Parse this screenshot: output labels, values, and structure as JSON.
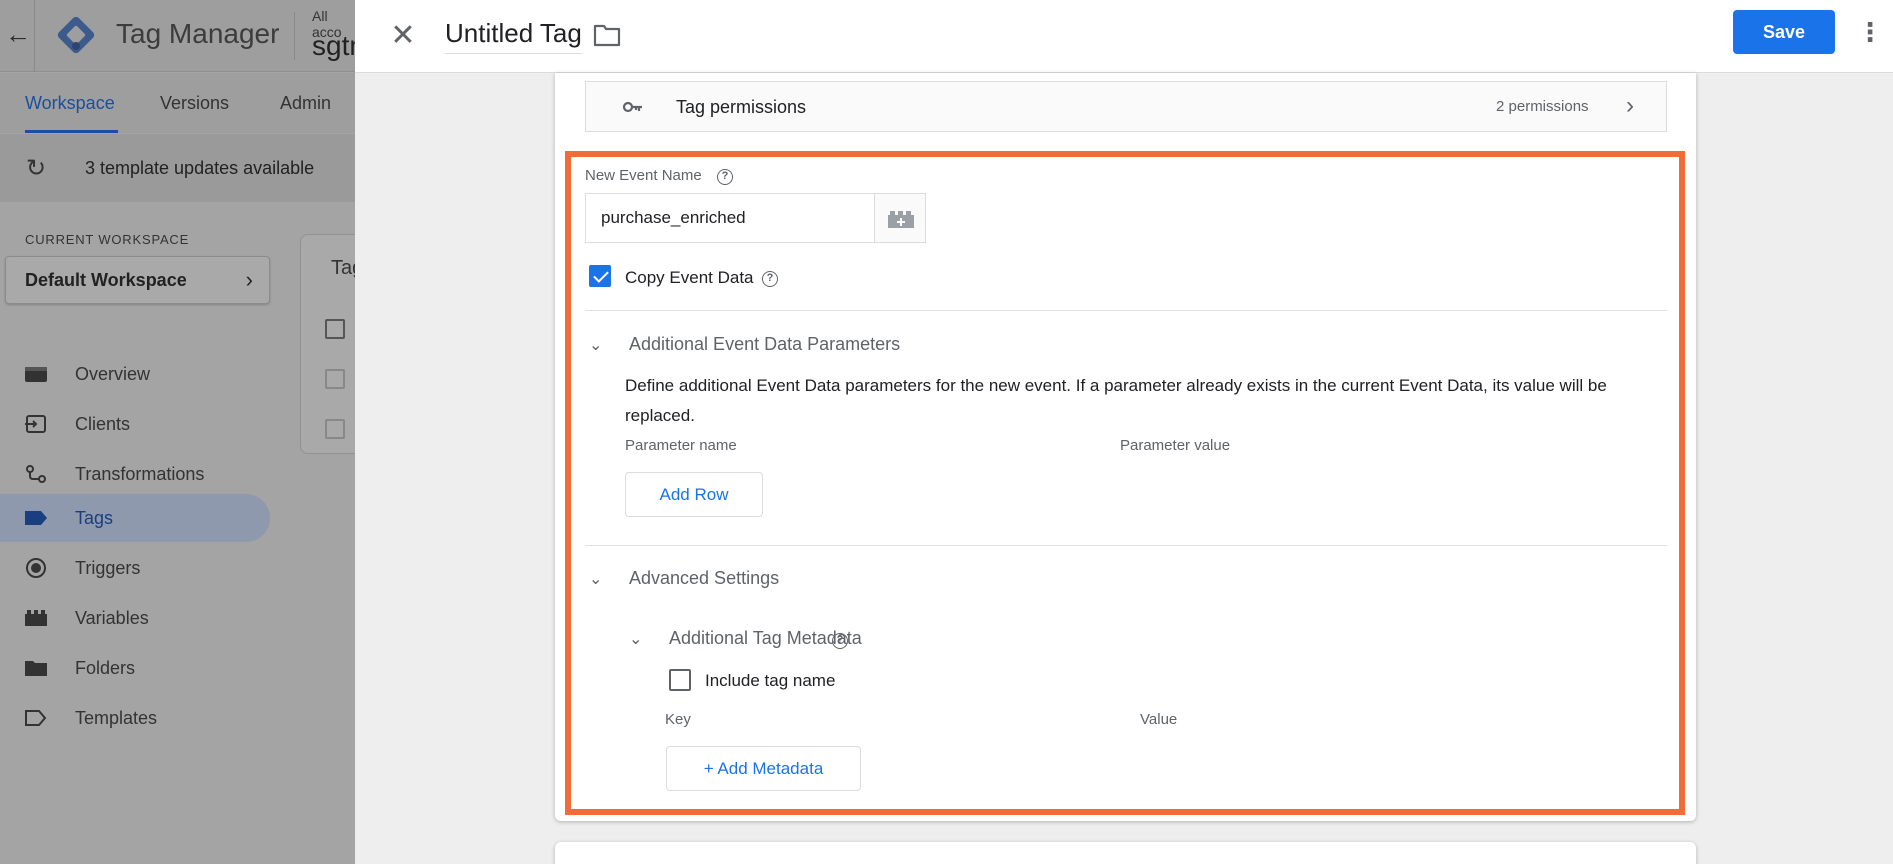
{
  "background_app": {
    "app_name": "Tag Manager",
    "account_small": "All acco",
    "account_big": "sgtm",
    "nav_tabs": [
      "Workspace",
      "Versions",
      "Admin"
    ],
    "banner_text": "3 template updates available",
    "workspace_caption": "CURRENT WORKSPACE",
    "workspace_name": "Default Workspace",
    "sidebar": [
      {
        "label": "Overview",
        "icon": "overview-icon"
      },
      {
        "label": "Clients",
        "icon": "clients-icon"
      },
      {
        "label": "Transformations",
        "icon": "transformations-icon"
      },
      {
        "label": "Tags",
        "icon": "tag-icon"
      },
      {
        "label": "Triggers",
        "icon": "triggers-icon"
      },
      {
        "label": "Variables",
        "icon": "variables-icon"
      },
      {
        "label": "Folders",
        "icon": "folder-icon"
      },
      {
        "label": "Templates",
        "icon": "templates-icon"
      }
    ],
    "selected_sidebar_item": "Tags",
    "card_title_partial": "Tag"
  },
  "editor": {
    "title": "Untitled Tag",
    "save_label": "Save",
    "permissions": {
      "label": "Tag permissions",
      "count": "2 permissions"
    },
    "new_event_name": {
      "label": "New Event Name",
      "value": "purchase_enriched"
    },
    "copy_event_data": {
      "label": "Copy Event Data",
      "checked": true
    },
    "additional_params": {
      "title": "Additional Event Data Parameters",
      "description": "Define additional Event Data parameters for the new event. If a parameter already exists in the current Event Data, its value will be replaced.",
      "col_name": "Parameter name",
      "col_value": "Parameter value",
      "add_row_label": "Add Row"
    },
    "advanced": {
      "title": "Advanced Settings",
      "metadata_title": "Additional Tag Metadata",
      "include_tag_name_label": "Include tag name",
      "include_tag_name_checked": false,
      "col_key": "Key",
      "col_value": "Value",
      "add_metadata_label": "+ Add Metadata"
    }
  },
  "colors": {
    "accent": "#1a73e8",
    "highlight": "#f36b36"
  }
}
